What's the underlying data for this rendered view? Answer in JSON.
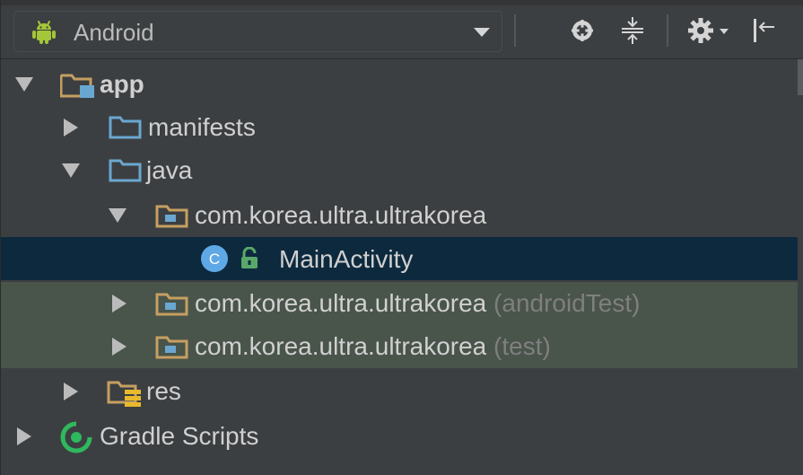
{
  "toolbar": {
    "view_label": "Android",
    "icons": [
      "locate-icon",
      "collapse-all-icon",
      "settings-icon",
      "hide-panel-icon"
    ]
  },
  "tree": {
    "app": {
      "label": "app",
      "state": "expanded"
    },
    "manifests": {
      "label": "manifests",
      "state": "collapsed"
    },
    "java": {
      "label": "java",
      "state": "expanded"
    },
    "package_main": {
      "label": "com.korea.ultra.ultrakorea",
      "state": "expanded"
    },
    "main_activity": {
      "label": "MainActivity",
      "class_badge": "C",
      "selected": true
    },
    "package_android_test": {
      "label": "com.korea.ultra.ultrakorea",
      "suffix": "(androidTest)",
      "state": "collapsed"
    },
    "package_test": {
      "label": "com.korea.ultra.ultrakorea",
      "suffix": "(test)",
      "state": "collapsed"
    },
    "res": {
      "label": "res",
      "state": "collapsed"
    },
    "gradle_scripts": {
      "label": "Gradle Scripts",
      "state": "collapsed"
    }
  },
  "colors": {
    "panel_bg": "#3c3f41",
    "selected_row": "#0d293e",
    "test_row": "#49544a",
    "android_green": "#a4c639",
    "folder_blue": "#6aa7d0",
    "package_tan": "#c69f61",
    "class_blue": "#5fa8e6",
    "lock_green": "#59a869",
    "gradle_green": "#2fb85e",
    "text": "#d0d0d0",
    "muted_text": "#7f7f7f"
  }
}
